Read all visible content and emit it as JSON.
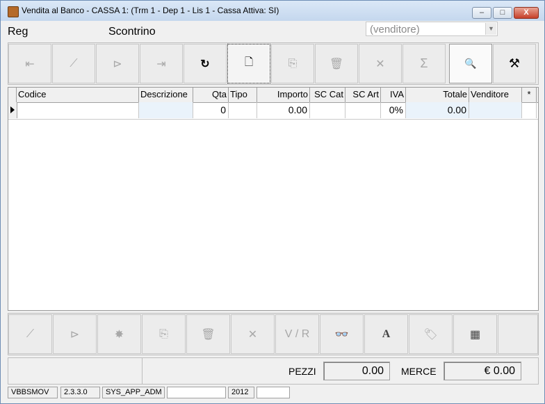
{
  "window": {
    "title": "Vendita al Banco - CASSA 1: (Trm  1 - Dep  1 - Lis  1 - Cassa Attiva: SI)",
    "min_label": "–",
    "max_label": "□",
    "close_label": "X"
  },
  "header": {
    "reg_label": "Reg",
    "scontrino_label": "Scontrino",
    "venditore_select": {
      "value": "(venditore)"
    }
  },
  "toolbar": {
    "first_icon": "⇤",
    "prev_icon": "⟋",
    "next_icon": "⊳",
    "last_icon": "⇥",
    "refresh_icon": "↻",
    "new_icon": "🗋",
    "copy_icon": "⎘",
    "delete_icon": "🗑",
    "cancel_icon": "✕",
    "sum_icon": "Σ",
    "preview_icon": "🔍",
    "tools_icon": "⚒"
  },
  "grid": {
    "columns": [
      "Codice",
      "Descrizione",
      "Qta",
      "Tipo",
      "Importo",
      "SC Cat",
      "SC Art",
      "IVA",
      "Totale",
      "Venditore",
      "*"
    ],
    "rows": [
      {
        "codice": "",
        "descrizione": "",
        "qta": "0",
        "tipo": "",
        "importo": "0.00",
        "sc_cat": "",
        "sc_art": "",
        "iva": "0%",
        "totale": "0.00",
        "venditore": "",
        "star": ""
      }
    ]
  },
  "toolbar2": {
    "prev_icon": "⟋",
    "next_icon": "⊳",
    "split_icon": "✸",
    "copy_icon": "⎘",
    "delete_icon": "🗑",
    "cancel_icon": "✕",
    "vr_label": "V / R",
    "search_icon": "👓",
    "font_icon": "A",
    "tag_icon": "🏷",
    "calc_icon": "▦",
    "blank": ""
  },
  "totals": {
    "pezzi_label": "PEZZI",
    "pezzi_value": "0.00",
    "merce_label": "MERCE",
    "merce_value": "€ 0.00"
  },
  "statusbar": {
    "module": "VBBSMOV",
    "version": "2.3.3.0",
    "user": "SYS_APP_ADM",
    "year": "2012"
  }
}
